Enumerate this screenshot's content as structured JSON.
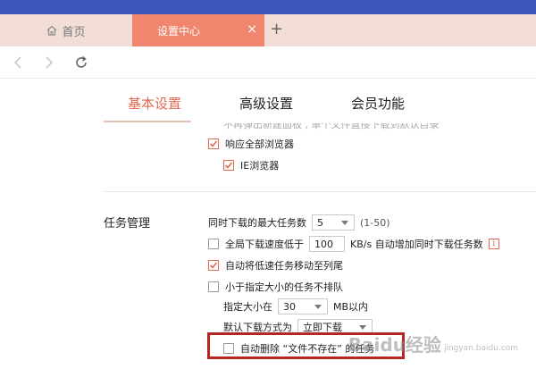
{
  "tabs": {
    "home_label": "首页",
    "active_label": "设置中心",
    "close_glyph": "×",
    "add_glyph": "+"
  },
  "settings_tabs": {
    "basic": "基本设置",
    "advanced": "高级设置",
    "member": "会员功能"
  },
  "browser_section": {
    "cut_text": "不再弹出新建面板 , 单个文件直接下载到默认目录",
    "respond_all_label": "响应全部浏览器",
    "respond_all_checked": true,
    "ie_label": "IE浏览器",
    "ie_checked": true
  },
  "task_section": {
    "title": "任务管理",
    "max_tasks_label": "同时下载的最大任务数",
    "max_tasks_value": "5",
    "max_tasks_range": "(1-50)",
    "speed_label": "全局下载速度低于",
    "speed_value": "100",
    "speed_suffix": "KB/s 自动增加同时下载任务数",
    "speed_checked": false,
    "info_glyph": "i",
    "move_slow_label": "自动将低速任务移动至列尾",
    "move_slow_checked": true,
    "small_no_queue_label": "小于指定大小的任务不排队",
    "small_no_queue_checked": false,
    "size_label": "指定大小在",
    "size_value": "30",
    "size_suffix": "MB以内",
    "default_mode_label": "默认下载方式为",
    "default_mode_value": "立即下载",
    "auto_delete_label": "自动删除 “文件不存在” 的任务",
    "auto_delete_checked": false
  },
  "watermark": {
    "text": "Baidu经验",
    "sub": "jingyan.baidu.com"
  },
  "colors": {
    "accent": "#e36a50",
    "active_tab": "#f0866d",
    "tab_bar": "#f3ddd7",
    "highlight_box": "#b5271f"
  }
}
